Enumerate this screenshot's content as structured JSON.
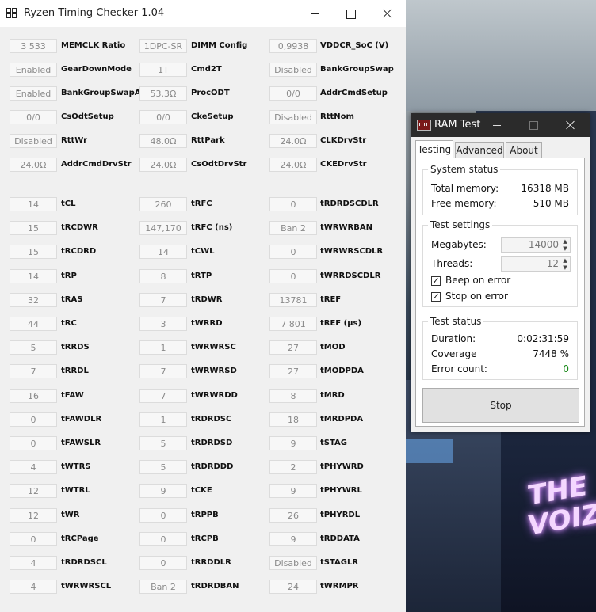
{
  "main_window": {
    "title": "Ryzen Timing Checker 1.04",
    "top_params": [
      {
        "value": "3 533",
        "label": "MEMCLK Ratio"
      },
      {
        "value": "1DPC-SR",
        "label": "DIMM Config"
      },
      {
        "value": "0,9938",
        "label": "VDDCR_SoC (V)"
      },
      {
        "value": "Enabled",
        "label": "GearDownMode"
      },
      {
        "value": "1T",
        "label": "Cmd2T"
      },
      {
        "value": "Disabled",
        "label": "BankGroupSwap"
      },
      {
        "value": "Enabled",
        "label": "BankGroupSwapAlt"
      },
      {
        "value": "53.3Ω",
        "label": "ProcODT"
      },
      {
        "value": "0/0",
        "label": "AddrCmdSetup"
      },
      {
        "value": "0/0",
        "label": "CsOdtSetup"
      },
      {
        "value": "0/0",
        "label": "CkeSetup"
      },
      {
        "value": "Disabled",
        "label": "RttNom"
      },
      {
        "value": "Disabled",
        "label": "RttWr"
      },
      {
        "value": "48.0Ω",
        "label": "RttPark"
      },
      {
        "value": "24.0Ω",
        "label": "CLKDrvStr"
      },
      {
        "value": "24.0Ω",
        "label": "AddrCmdDrvStr"
      },
      {
        "value": "24.0Ω",
        "label": "CsOdtDrvStr"
      },
      {
        "value": "24.0Ω",
        "label": "CKEDrvStr"
      }
    ],
    "timings": [
      {
        "value": "14",
        "label": "tCL"
      },
      {
        "value": "260",
        "label": "tRFC"
      },
      {
        "value": "0",
        "label": "tRDRDSCDLR"
      },
      {
        "value": "15",
        "label": "tRCDWR"
      },
      {
        "value": "147,170",
        "label": "tRFC (ns)"
      },
      {
        "value": "Ban 2",
        "label": "tWRWRBAN"
      },
      {
        "value": "15",
        "label": "tRCDRD"
      },
      {
        "value": "14",
        "label": "tCWL"
      },
      {
        "value": "0",
        "label": "tWRWRSCDLR"
      },
      {
        "value": "14",
        "label": "tRP"
      },
      {
        "value": "8",
        "label": "tRTP"
      },
      {
        "value": "0",
        "label": "tWRRDSCDLR"
      },
      {
        "value": "32",
        "label": "tRAS"
      },
      {
        "value": "7",
        "label": "tRDWR"
      },
      {
        "value": "13781",
        "label": "tREF"
      },
      {
        "value": "44",
        "label": "tRC"
      },
      {
        "value": "3",
        "label": "tWRRD"
      },
      {
        "value": "7 801",
        "label": "tREF (µs)"
      },
      {
        "value": "5",
        "label": "tRRDS"
      },
      {
        "value": "1",
        "label": "tWRWRSC"
      },
      {
        "value": "27",
        "label": "tMOD"
      },
      {
        "value": "7",
        "label": "tRRDL"
      },
      {
        "value": "7",
        "label": "tWRWRSD"
      },
      {
        "value": "27",
        "label": "tMODPDA"
      },
      {
        "value": "16",
        "label": "tFAW"
      },
      {
        "value": "7",
        "label": "tWRWRDD"
      },
      {
        "value": "8",
        "label": "tMRD"
      },
      {
        "value": "0",
        "label": "tFAWDLR"
      },
      {
        "value": "1",
        "label": "tRDRDSC"
      },
      {
        "value": "18",
        "label": "tMRDPDA"
      },
      {
        "value": "0",
        "label": "tFAWSLR"
      },
      {
        "value": "5",
        "label": "tRDRDSD"
      },
      {
        "value": "9",
        "label": "tSTAG"
      },
      {
        "value": "4",
        "label": "tWTRS"
      },
      {
        "value": "5",
        "label": "tRDRDDD"
      },
      {
        "value": "2",
        "label": "tPHYWRD"
      },
      {
        "value": "12",
        "label": "tWTRL"
      },
      {
        "value": "9",
        "label": "tCKE"
      },
      {
        "value": "9",
        "label": "tPHYWRL"
      },
      {
        "value": "12",
        "label": "tWR"
      },
      {
        "value": "0",
        "label": "tRPPB"
      },
      {
        "value": "26",
        "label": "tPHYRDL"
      },
      {
        "value": "0",
        "label": "tRCPage"
      },
      {
        "value": "0",
        "label": "tRCPB"
      },
      {
        "value": "9",
        "label": "tRDDATA"
      },
      {
        "value": "4",
        "label": "tRDRDSCL"
      },
      {
        "value": "0",
        "label": "tRRDDLR"
      },
      {
        "value": "Disabled",
        "label": "tSTAGLR"
      },
      {
        "value": "4",
        "label": "tWRWRSCL"
      },
      {
        "value": "Ban 2",
        "label": "tRDRDBAN"
      },
      {
        "value": "24",
        "label": "tWRMPR"
      }
    ]
  },
  "ram_test": {
    "title": "RAM Test",
    "tabs": [
      "Testing",
      "Advanced",
      "About"
    ],
    "system_status": {
      "title": "System status",
      "total_label": "Total memory:",
      "total_value": "16318 MB",
      "free_label": "Free memory:",
      "free_value": "510 MB"
    },
    "test_settings": {
      "title": "Test settings",
      "megabytes_label": "Megabytes:",
      "megabytes_value": "14000",
      "threads_label": "Threads:",
      "threads_value": "12",
      "beep_label": "Beep on error",
      "stop_label": "Stop on error"
    },
    "test_status": {
      "title": "Test status",
      "duration_label": "Duration:",
      "duration_value": "0:02:31:59",
      "coverage_label": "Coverage",
      "coverage_value": "7448 %",
      "errors_label": "Error count:",
      "errors_value": "0",
      "errors_color": "#1a8a1a"
    },
    "stop_button": "Stop"
  },
  "wallpaper": {
    "sign_text": "THE VOIZE"
  }
}
